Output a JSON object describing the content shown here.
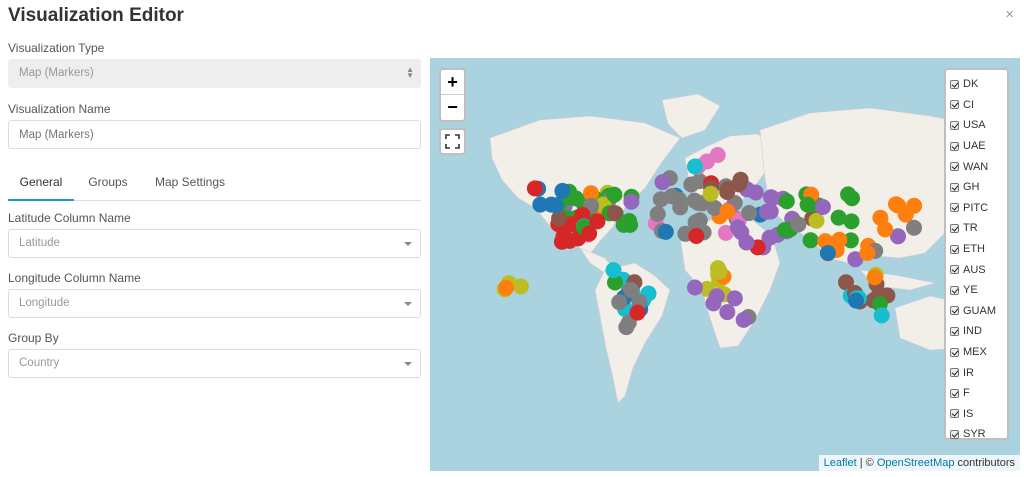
{
  "dialog": {
    "title": "Visualization Editor",
    "close_glyph": "×"
  },
  "fields": {
    "viz_type": {
      "label": "Visualization Type",
      "value": "Map (Markers)"
    },
    "viz_name": {
      "label": "Visualization Name",
      "placeholder": "Map (Markers)"
    },
    "latitude": {
      "label": "Latitude Column Name",
      "value": "Latitude"
    },
    "longitude": {
      "label": "Longitude Column Name",
      "value": "Longitude"
    },
    "group_by": {
      "label": "Group By",
      "value": "Country"
    }
  },
  "tabs": [
    {
      "label": "General",
      "active": true
    },
    {
      "label": "Groups",
      "active": false
    },
    {
      "label": "Map Settings",
      "active": false
    }
  ],
  "map": {
    "zoom_in": "+",
    "zoom_out": "−",
    "attribution": {
      "leaflet": "Leaflet",
      "sep": " | © ",
      "osm": "OpenStreetMap",
      "suffix": " contributors"
    },
    "legend": [
      {
        "label": "DK",
        "color": "#1f77b4"
      },
      {
        "label": "CI",
        "color": "#ff7f0e"
      },
      {
        "label": "USA",
        "color": "#2ca02c"
      },
      {
        "label": "UAE",
        "color": "#d62728"
      },
      {
        "label": "WAN",
        "color": "#9467bd"
      },
      {
        "label": "GH",
        "color": "#8c564b"
      },
      {
        "label": "PITC",
        "color": "#e377c2"
      },
      {
        "label": "TR",
        "color": "#7f7f7f"
      },
      {
        "label": "ETH",
        "color": "#bcbd22"
      },
      {
        "label": "AUS",
        "color": "#17becf"
      },
      {
        "label": "YE",
        "color": "#1f77b4"
      },
      {
        "label": "GUAM",
        "color": "#ff7f0e"
      },
      {
        "label": "IND",
        "color": "#2ca02c"
      },
      {
        "label": "MEX",
        "color": "#d62728"
      },
      {
        "label": "IR",
        "color": "#9467bd"
      },
      {
        "label": "F",
        "color": "#8c564b"
      },
      {
        "label": "IS",
        "color": "#e377c2"
      },
      {
        "label": "SYR",
        "color": "#7f7f7f"
      }
    ]
  }
}
